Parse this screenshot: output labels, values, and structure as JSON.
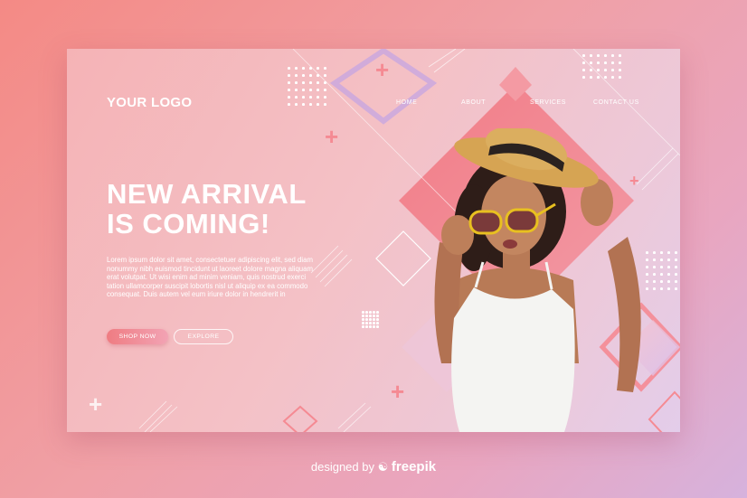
{
  "logo": "YOUR LOGO",
  "nav": {
    "items": [
      "HOME",
      "ABOUT",
      "SERVICES",
      "CONTACT US"
    ]
  },
  "hero": {
    "headline_line1": "NEW ARRIVAL",
    "headline_line2": "IS COMING!",
    "body": "Lorem ipsum dolor sit amet, consectetuer adipiscing elit, sed diam nonummy nibh euismod tincidunt ut laoreet dolore magna aliquam erat volutpat. Ut wisi enim ad minim veniam, quis nostrud exerci tation ullamcorper suscipit lobortis nisl ut aliquip ex ea commodo consequat. Duis autem vel eum iriure dolor in hendrerit in"
  },
  "buttons": {
    "shop": "SHOP NOW",
    "explore": "EXPLORE"
  },
  "footer": {
    "prefix": "designed by",
    "brand": "freepik"
  },
  "colors": {
    "accent": "#ef7c82",
    "diamond": "#f2868e",
    "text": "#ffffff"
  }
}
